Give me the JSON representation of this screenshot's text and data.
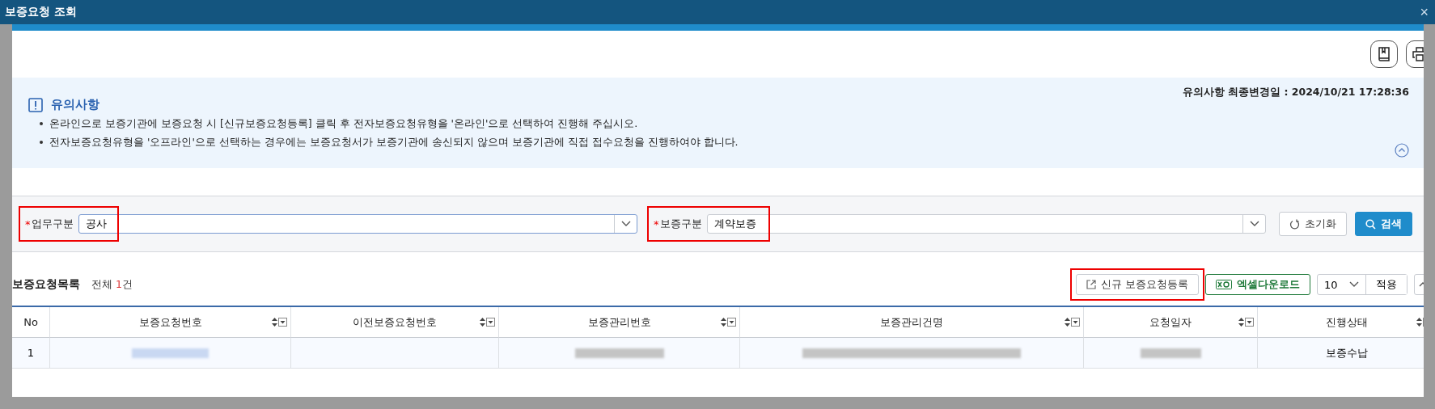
{
  "page": {
    "title": "보증요청 조회",
    "close": "×"
  },
  "notice": {
    "title": "유의사항",
    "updated": "유의사항 최종변경일 : 2024/10/21 17:28:36",
    "expanded": true,
    "items": [
      "온라인으로 보증기관에 보증요청 시 [신규보증요청등록] 클릭 후 전자보증요청유형을 '온라인'으로 선택하여 진행해 주십시오.",
      "전자보증요청유형을 '오프라인'으로 선택하는 경우에는 보증요청서가 보증기관에 송신되지 않으며 보증기관에 직접 접수요청을 진행하여야 합니다."
    ]
  },
  "filters": [
    {
      "required_mark": "*",
      "label": "업무구분",
      "value": "공사",
      "focused": true,
      "highlighted": true
    },
    {
      "required_mark": "*",
      "label": "보증구분",
      "value": "계약보증",
      "focused": false,
      "highlighted": true
    }
  ],
  "filter_buttons": [
    {
      "kind": "reset",
      "label": "초기화"
    },
    {
      "kind": "search",
      "label": "검색"
    }
  ],
  "list": {
    "title": "보증요청목록",
    "total_prefix": "전체 ",
    "total_count": "1",
    "total_suffix": "건",
    "actions": [
      {
        "kind": "new",
        "label": "신규 보증요청등록",
        "highlighted": true
      },
      {
        "kind": "excel",
        "label": "엑셀다운로드"
      }
    ],
    "page_size": "10",
    "apply": "적용"
  },
  "table": {
    "columns": [
      {
        "label": "No",
        "sortable": false
      },
      {
        "label": "보증요청번호",
        "sortable": true
      },
      {
        "label": "이전보증요청번호",
        "sortable": true
      },
      {
        "label": "보증관리번호",
        "sortable": true
      },
      {
        "label": "보증관리건명",
        "sortable": true
      },
      {
        "label": "요청일자",
        "sortable": true
      },
      {
        "label": "진행상태",
        "sortable": true
      }
    ],
    "rows": [
      [
        {
          "kind": "text",
          "text": "1"
        },
        {
          "kind": "redacted_link"
        },
        {
          "kind": "empty"
        },
        {
          "kind": "redacted"
        },
        {
          "kind": "redacted"
        },
        {
          "kind": "redacted"
        },
        {
          "kind": "text",
          "text": "보증수납"
        }
      ]
    ]
  }
}
